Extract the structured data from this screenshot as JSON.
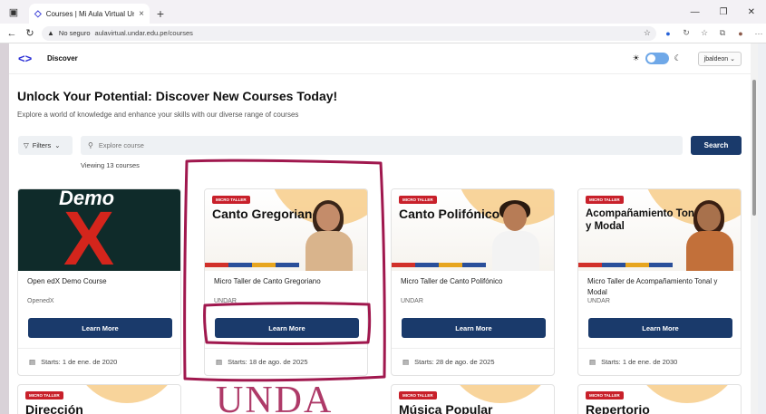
{
  "browser": {
    "tab_title": "Courses | Mi Aula Virtual Undar",
    "security_label": "No seguro",
    "url": "aulavirtual.undar.edu.pe/courses"
  },
  "nav": {
    "discover": "Discover",
    "user": "jbaldeon"
  },
  "hero": {
    "title": "Unlock Your Potential: Discover New Courses Today!",
    "subtitle": "Explore a world of knowledge and enhance your skills with our diverse range of courses"
  },
  "search": {
    "filters_label": "Filters",
    "placeholder": "Explore course",
    "button_label": "Search",
    "viewing": "Viewing 13 courses"
  },
  "courses": [
    {
      "name": "Open edX Demo Course",
      "org": "OpenedX",
      "learn": "Learn More",
      "starts": "Starts: 1 de ene. de 2020",
      "thumb_word": "Demo",
      "thumb_x": "X"
    },
    {
      "name": "Micro Taller de Canto Gregoriano",
      "org": "UNDAR",
      "learn": "Learn More",
      "starts": "Starts: 18 de ago. de 2025",
      "badge": "MICRO TALLER",
      "thumb_title": "Canto Gregoriano"
    },
    {
      "name": "Micro Taller de Canto Polifónico",
      "org": "UNDAR",
      "learn": "Learn More",
      "starts": "Starts: 28 de ago. de 2025",
      "badge": "MICRO TALLER",
      "thumb_title": "Canto Polifónico"
    },
    {
      "name": "Micro Taller de Acompañamiento Tonal y Modal",
      "org": "UNDAR",
      "learn": "Learn More",
      "starts": "Starts: 1 de ene. de 2030",
      "badge": "MICRO TALLER",
      "thumb_title": "Acompañamiento Tonal y Modal"
    }
  ],
  "second_row": [
    {
      "badge": "MICRO TALLER",
      "thumb_title": "Dirección"
    },
    {
      "badge": "",
      "thumb_title": ""
    },
    {
      "badge": "MICRO TALLER",
      "thumb_title": "Música Popular"
    },
    {
      "badge": "MICRO TALLER",
      "thumb_title": "Repertorio"
    }
  ],
  "watermark": "UNDA",
  "colors": {
    "primary": "#1a3a6b",
    "logo": "#2b2fd6",
    "annotation": "#a0184e",
    "badge": "#c8202a"
  }
}
